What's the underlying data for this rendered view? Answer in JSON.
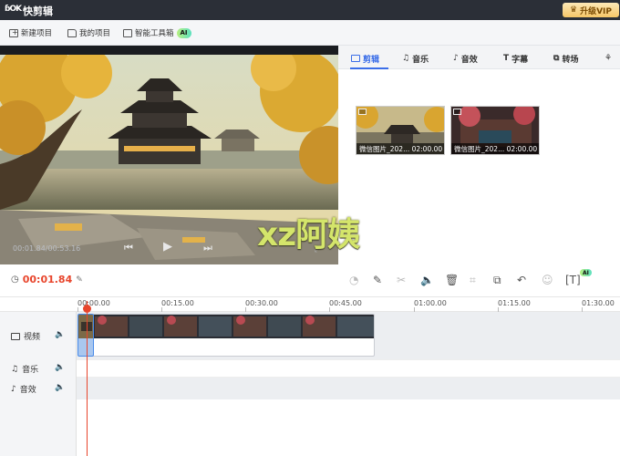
{
  "app": {
    "logo_text": "ɓOK",
    "title": "快剪辑",
    "vip_label": "升级VIP"
  },
  "toolbar": {
    "new_project": "新建项目",
    "my_projects": "我的项目",
    "toolbox": "智能工具箱",
    "ai_badge": "AI"
  },
  "preview": {
    "timecode": "00:01.84/00:53.16",
    "watermark": "xz阿姨"
  },
  "tabs": [
    {
      "label": "剪辑",
      "icon": "video-icon",
      "active": true
    },
    {
      "label": "音乐",
      "icon": "music-icon"
    },
    {
      "label": "音效",
      "icon": "sound-effect-icon"
    },
    {
      "label": "字幕",
      "icon": "text-icon"
    },
    {
      "label": "转场",
      "icon": "transition-icon"
    },
    {
      "label": "",
      "icon": "sticker-icon"
    }
  ],
  "media": [
    {
      "name": "微信图片_202...",
      "duration": "02:00.00"
    },
    {
      "name": "微信图片_202...",
      "duration": "02:00.00"
    }
  ],
  "timeline": {
    "current_time": "00:01.84",
    "ruler": [
      "00:00.00",
      "00:15.00",
      "00:30.00",
      "00:45.00",
      "01:00.00",
      "01:15.00",
      "01:30.00"
    ],
    "ai_badge": "AI",
    "tracks": [
      {
        "label": "视频",
        "icon": "video-track-icon"
      },
      {
        "label": "音乐",
        "icon": "music-track-icon"
      },
      {
        "label": "音效",
        "icon": "sound-effect-track-icon"
      }
    ]
  },
  "colors": {
    "accent": "#3b6ee8",
    "playhead": "#e8452c",
    "titlebar": "#2b2f37",
    "vip": "#f6c667"
  }
}
